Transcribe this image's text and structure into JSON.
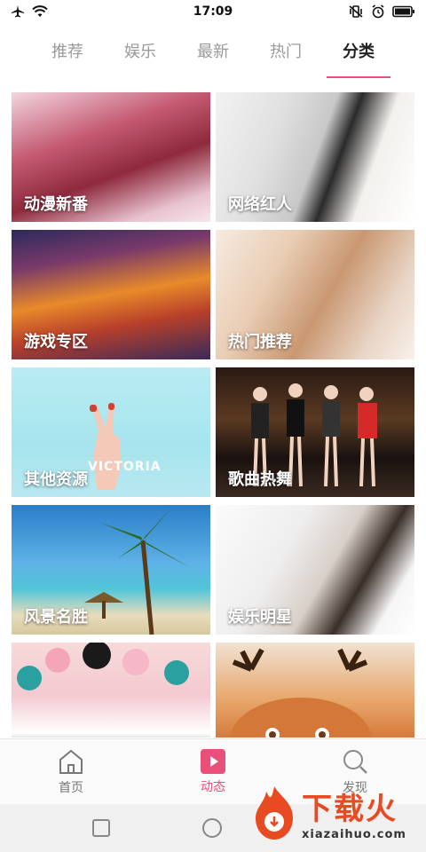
{
  "status": {
    "time": "17:09",
    "left_icons": [
      "airplane-icon",
      "wifi-icon"
    ],
    "right_icons": [
      "vibrate-icon",
      "alarm-icon",
      "battery-icon"
    ]
  },
  "tabs": [
    {
      "label": "推荐",
      "active": false
    },
    {
      "label": "娱乐",
      "active": false
    },
    {
      "label": "最新",
      "active": false
    },
    {
      "label": "热门",
      "active": false
    },
    {
      "label": "分类",
      "active": true
    }
  ],
  "accent_color": "#e8507a",
  "categories": [
    {
      "label": "动漫新番"
    },
    {
      "label": "网络红人"
    },
    {
      "label": "游戏专区"
    },
    {
      "label": "热门推荐"
    },
    {
      "label": "其他资源",
      "image_text": "VICTORIA"
    },
    {
      "label": "歌曲热舞"
    },
    {
      "label": "风景名胜"
    },
    {
      "label": "娱乐明星"
    },
    {
      "label": ""
    },
    {
      "label": ""
    }
  ],
  "bottom_nav": [
    {
      "label": "首页",
      "icon": "home-icon",
      "active": false
    },
    {
      "label": "动态",
      "icon": "play-icon",
      "active": true
    },
    {
      "label": "发现",
      "icon": "search-icon",
      "active": false
    }
  ],
  "watermark": {
    "cn": "下载火",
    "en": "xiazaihuo.com"
  }
}
